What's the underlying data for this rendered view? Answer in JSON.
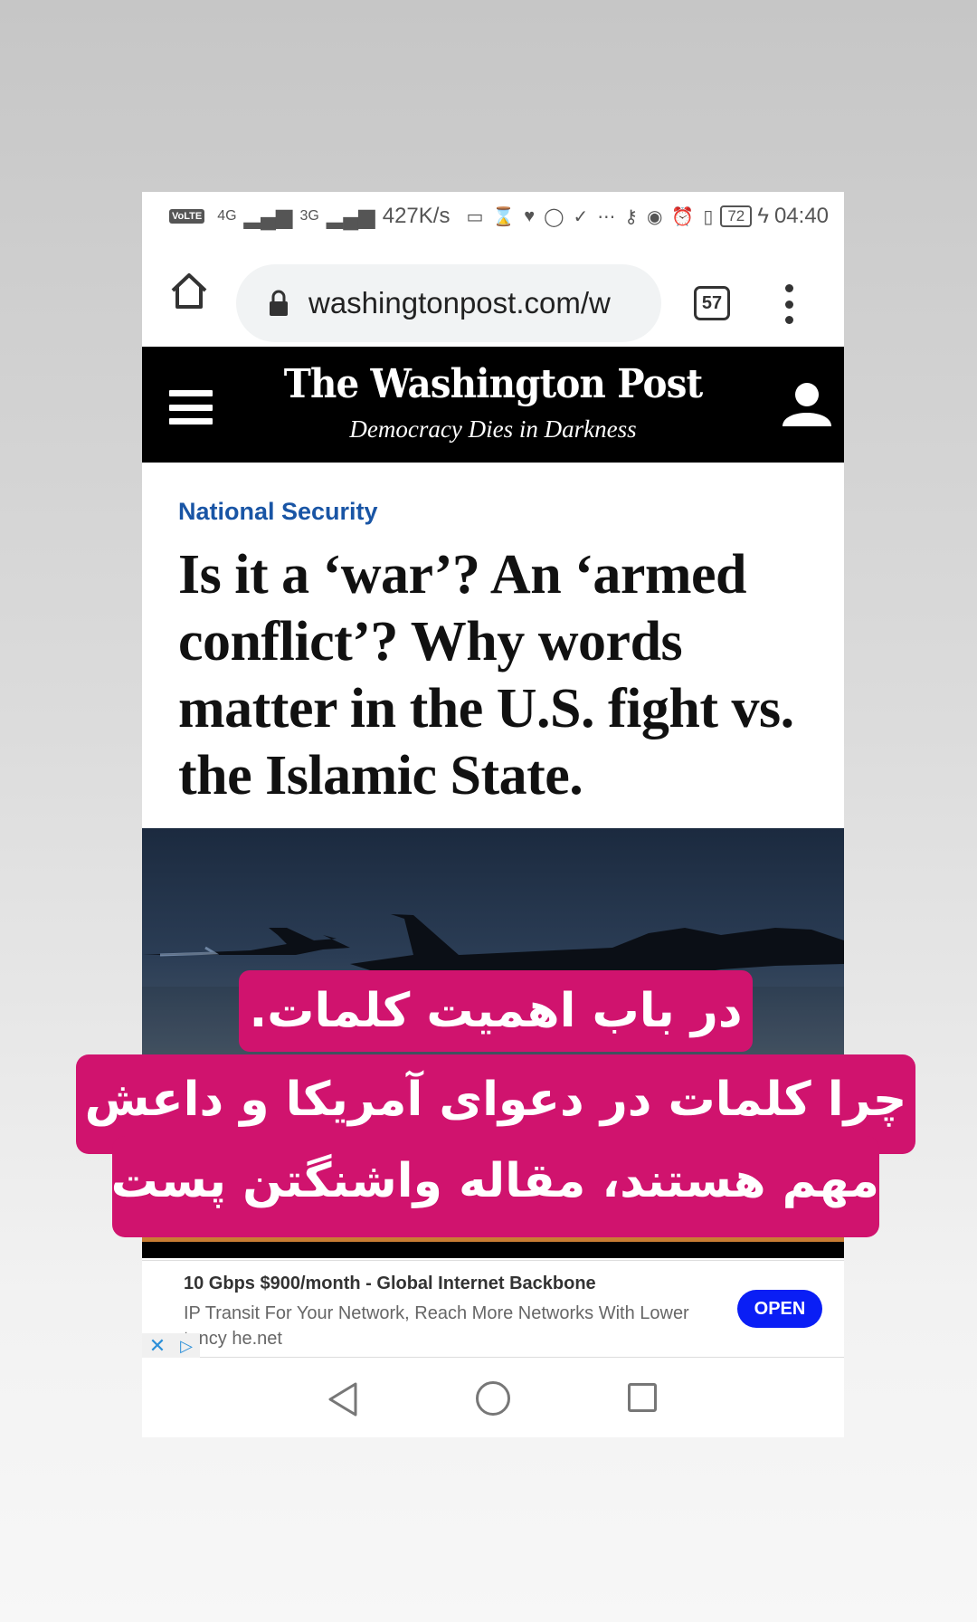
{
  "status_bar": {
    "volte": "VoLTE",
    "net1": "4G",
    "net2": "3G",
    "speed": "427K/s",
    "battery": "72",
    "time": "04:40"
  },
  "browser": {
    "url": "washingtonpost.com/w",
    "tab_count": "57"
  },
  "site": {
    "masthead": "The Washington Post",
    "tagline": "Democracy Dies in Darkness"
  },
  "article": {
    "kicker": "National Security",
    "headline": "Is it a ‘war’? An ‘armed conflict’? Why words matter in the U.S. fight vs. the Islamic State."
  },
  "ad": {
    "title": "10 Gbps $900/month - Global Internet Backbone",
    "description": "IP Transit For Your Network, Reach More Networks With Lower",
    "description_tail": "tency he.net",
    "cta": "OPEN"
  },
  "overlay": {
    "line1": "در باب اهمیت کلمات.",
    "line2": "چرا کلمات در دعوای آمریکا و داعش",
    "line3": "مهم هستند، مقاله واشنگتن پست",
    "color": "#d0136e"
  },
  "icons": {
    "home": "home-icon",
    "lock": "lock-icon",
    "tabs": "tabs-icon",
    "menu": "menu-icon",
    "hamburger": "hamburger-icon",
    "user": "user-icon",
    "back": "nav-back-icon",
    "nav_home": "nav-home-icon",
    "recent": "nav-recent-icon"
  }
}
